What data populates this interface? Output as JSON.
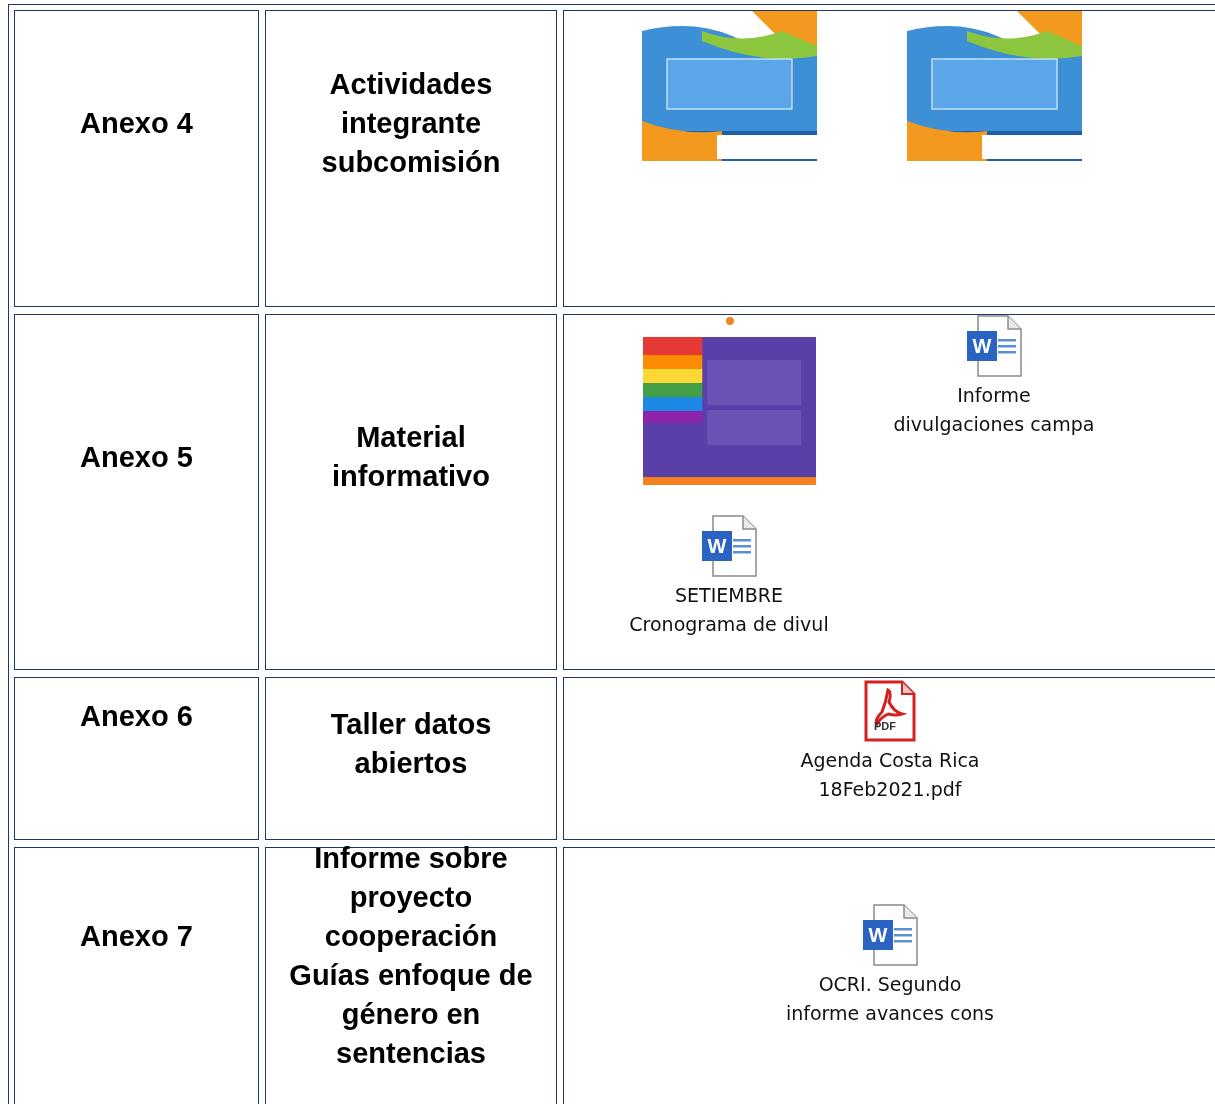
{
  "table": {
    "rows": [
      {
        "label": "Anexo 4",
        "title": "Actividades integrante subcomisión",
        "attachments": [
          {
            "kind": "picture"
          },
          {
            "kind": "picture"
          }
        ]
      },
      {
        "label": "Anexo 5",
        "title": "Material informativo",
        "attachments": [
          {
            "kind": "picture"
          },
          {
            "kind": "word",
            "badge": "W",
            "lines": [
              "Informe",
              "divulgaciones campa"
            ]
          },
          {
            "kind": "word",
            "badge": "W",
            "lines": [
              "SETIEMBRE",
              "Cronograma de divul"
            ]
          }
        ]
      },
      {
        "label": "Anexo 6",
        "title": "Taller datos abiertos",
        "attachments": [
          {
            "kind": "pdf",
            "badge": "PDF",
            "lines": [
              "Agenda Costa Rica",
              "18Feb2021.pdf"
            ]
          }
        ]
      },
      {
        "label": "Anexo 7",
        "title": "Informe sobre proyecto cooperación Guías enfoque de género en sentencias",
        "attachments": [
          {
            "kind": "word",
            "badge": "W",
            "lines": [
              "OCRI. Segundo",
              "informe avances cons"
            ]
          }
        ]
      }
    ]
  }
}
